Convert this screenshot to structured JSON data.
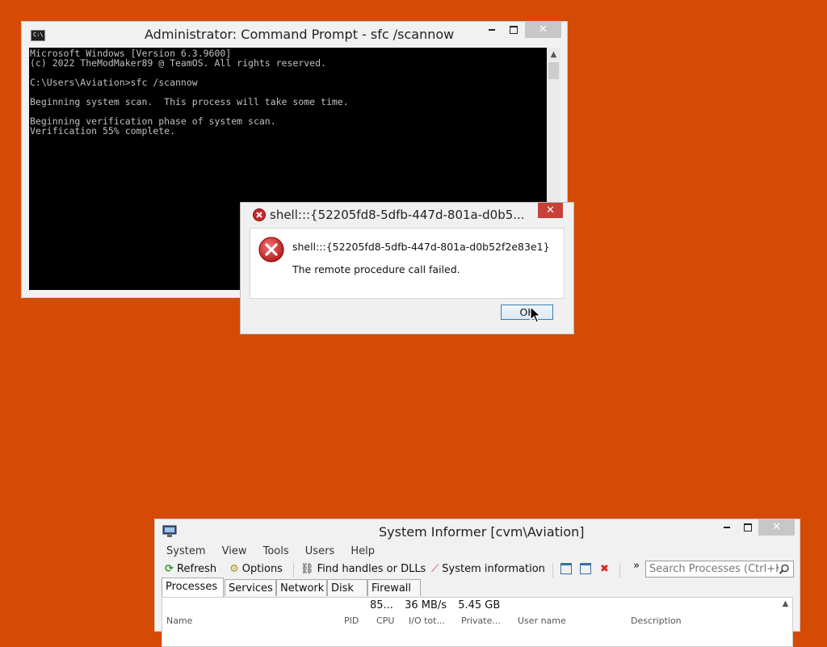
{
  "cmd": {
    "title": "Administrator: Command Prompt - sfc  /scannow",
    "lines": [
      "Microsoft Windows [Version 6.3.9600]",
      "(c) 2022 TheModMaker89 @ TeamOS. All rights reserved.",
      "",
      "C:\\Users\\Aviation>sfc /scannow",
      "",
      "Beginning system scan.  This process will take some time.",
      "",
      "Beginning verification phase of system scan.",
      "Verification 55% complete."
    ]
  },
  "dialog": {
    "title": "shell:::{52205fd8-5dfb-447d-801a-d0b5...",
    "message_line1": "shell:::{52205fd8-5dfb-447d-801a-d0b52f2e83e1}",
    "message_line2": "The remote procedure call failed.",
    "ok_label": "OK"
  },
  "sysinfo": {
    "title": "System Informer [cvm\\Aviation]",
    "menu": [
      "System",
      "View",
      "Tools",
      "Users",
      "Help"
    ],
    "toolbar": {
      "refresh": "Refresh",
      "options": "Options",
      "find_handles": "Find handles or DLLs",
      "system_information": "System information",
      "more": "»"
    },
    "search_placeholder": "Search Processes (Ctrl+K)",
    "tabs": [
      "Processes",
      "Services",
      "Network",
      "Disk",
      "Firewall"
    ],
    "stats": {
      "cpu": "85...",
      "io": "36 MB/s",
      "memory": "5.45 GB"
    },
    "columns": [
      "Name",
      "PID",
      "CPU",
      "I/O tot...",
      "Private...",
      "User name",
      "Description"
    ]
  },
  "caption": {
    "minimize": "▬",
    "maximize": "□",
    "close": "✕"
  },
  "colors": {
    "desktop": "#d54a05",
    "close_red": "#c7413b",
    "error_red": "#c8262b"
  }
}
